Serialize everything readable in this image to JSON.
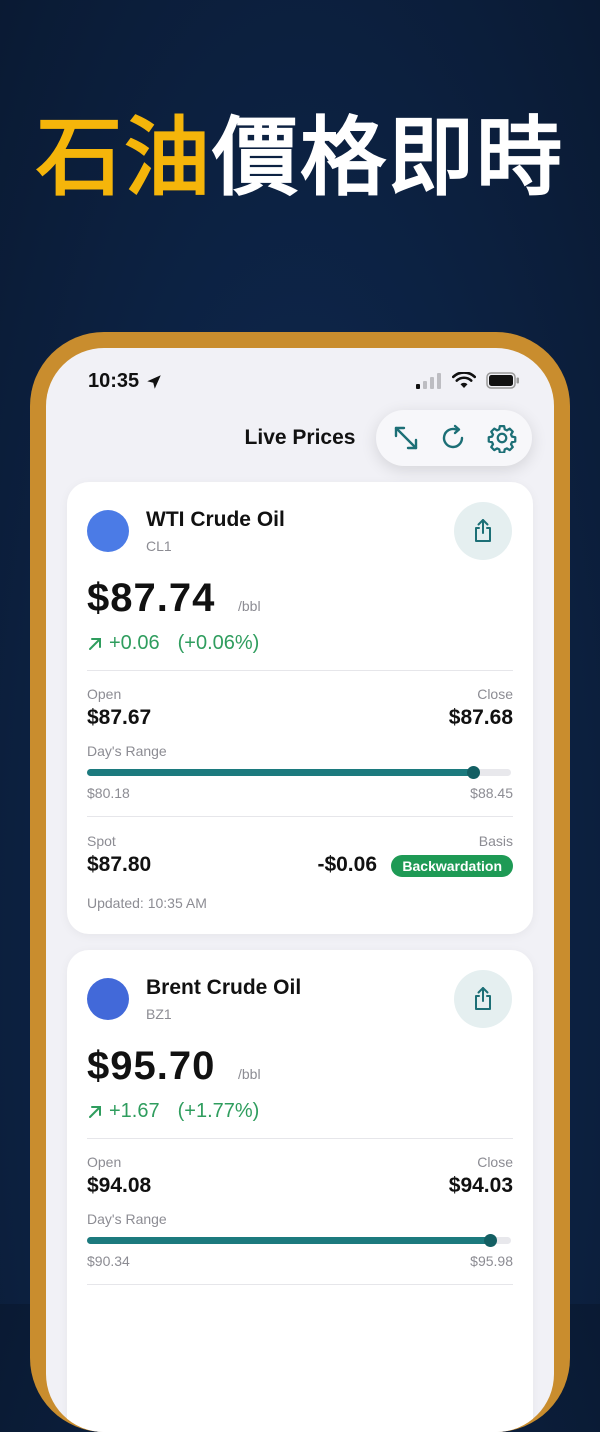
{
  "headline": {
    "part_accent": "石油",
    "part_rest": "價格即時"
  },
  "status_bar": {
    "time": "10:35"
  },
  "nav": {
    "title": "Live Prices"
  },
  "colors": {
    "accent_yellow": "#f5b50a",
    "frame_gold": "#c98d2e",
    "up_green": "#2f9d5e",
    "teal": "#1c7a7e",
    "badge_green": "#1e9a55"
  },
  "icons": [
    "location-arrow-icon",
    "signal-icon",
    "wifi-icon",
    "battery-icon",
    "expand-icon",
    "refresh-icon",
    "gear-icon",
    "share-icon",
    "arrow-up-right-icon"
  ],
  "cards": [
    {
      "name": "WTI Crude Oil",
      "symbol": "CL1",
      "price": "$87.74",
      "unit": "/bbl",
      "change": "+0.06",
      "change_pct": "(+0.06%)",
      "open_label": "Open",
      "open": "$87.67",
      "close_label": "Close",
      "close": "$87.68",
      "range_label": "Day's Range",
      "range_low": "$80.18",
      "range_high": "$88.45",
      "range_position": 0.91,
      "spot_label": "Spot",
      "spot": "$87.80",
      "basis_label": "Basis",
      "basis": "-$0.06",
      "basis_badge": "Backwardation",
      "updated": "Updated: 10:35 AM"
    },
    {
      "name": "Brent Crude Oil",
      "symbol": "BZ1",
      "price": "$95.70",
      "unit": "/bbl",
      "change": "+1.67",
      "change_pct": "(+1.77%)",
      "open_label": "Open",
      "open": "$94.08",
      "close_label": "Close",
      "close": "$94.03",
      "range_label": "Day's Range",
      "range_low": "$90.34",
      "range_high": "$95.98",
      "range_position": 0.95
    }
  ]
}
